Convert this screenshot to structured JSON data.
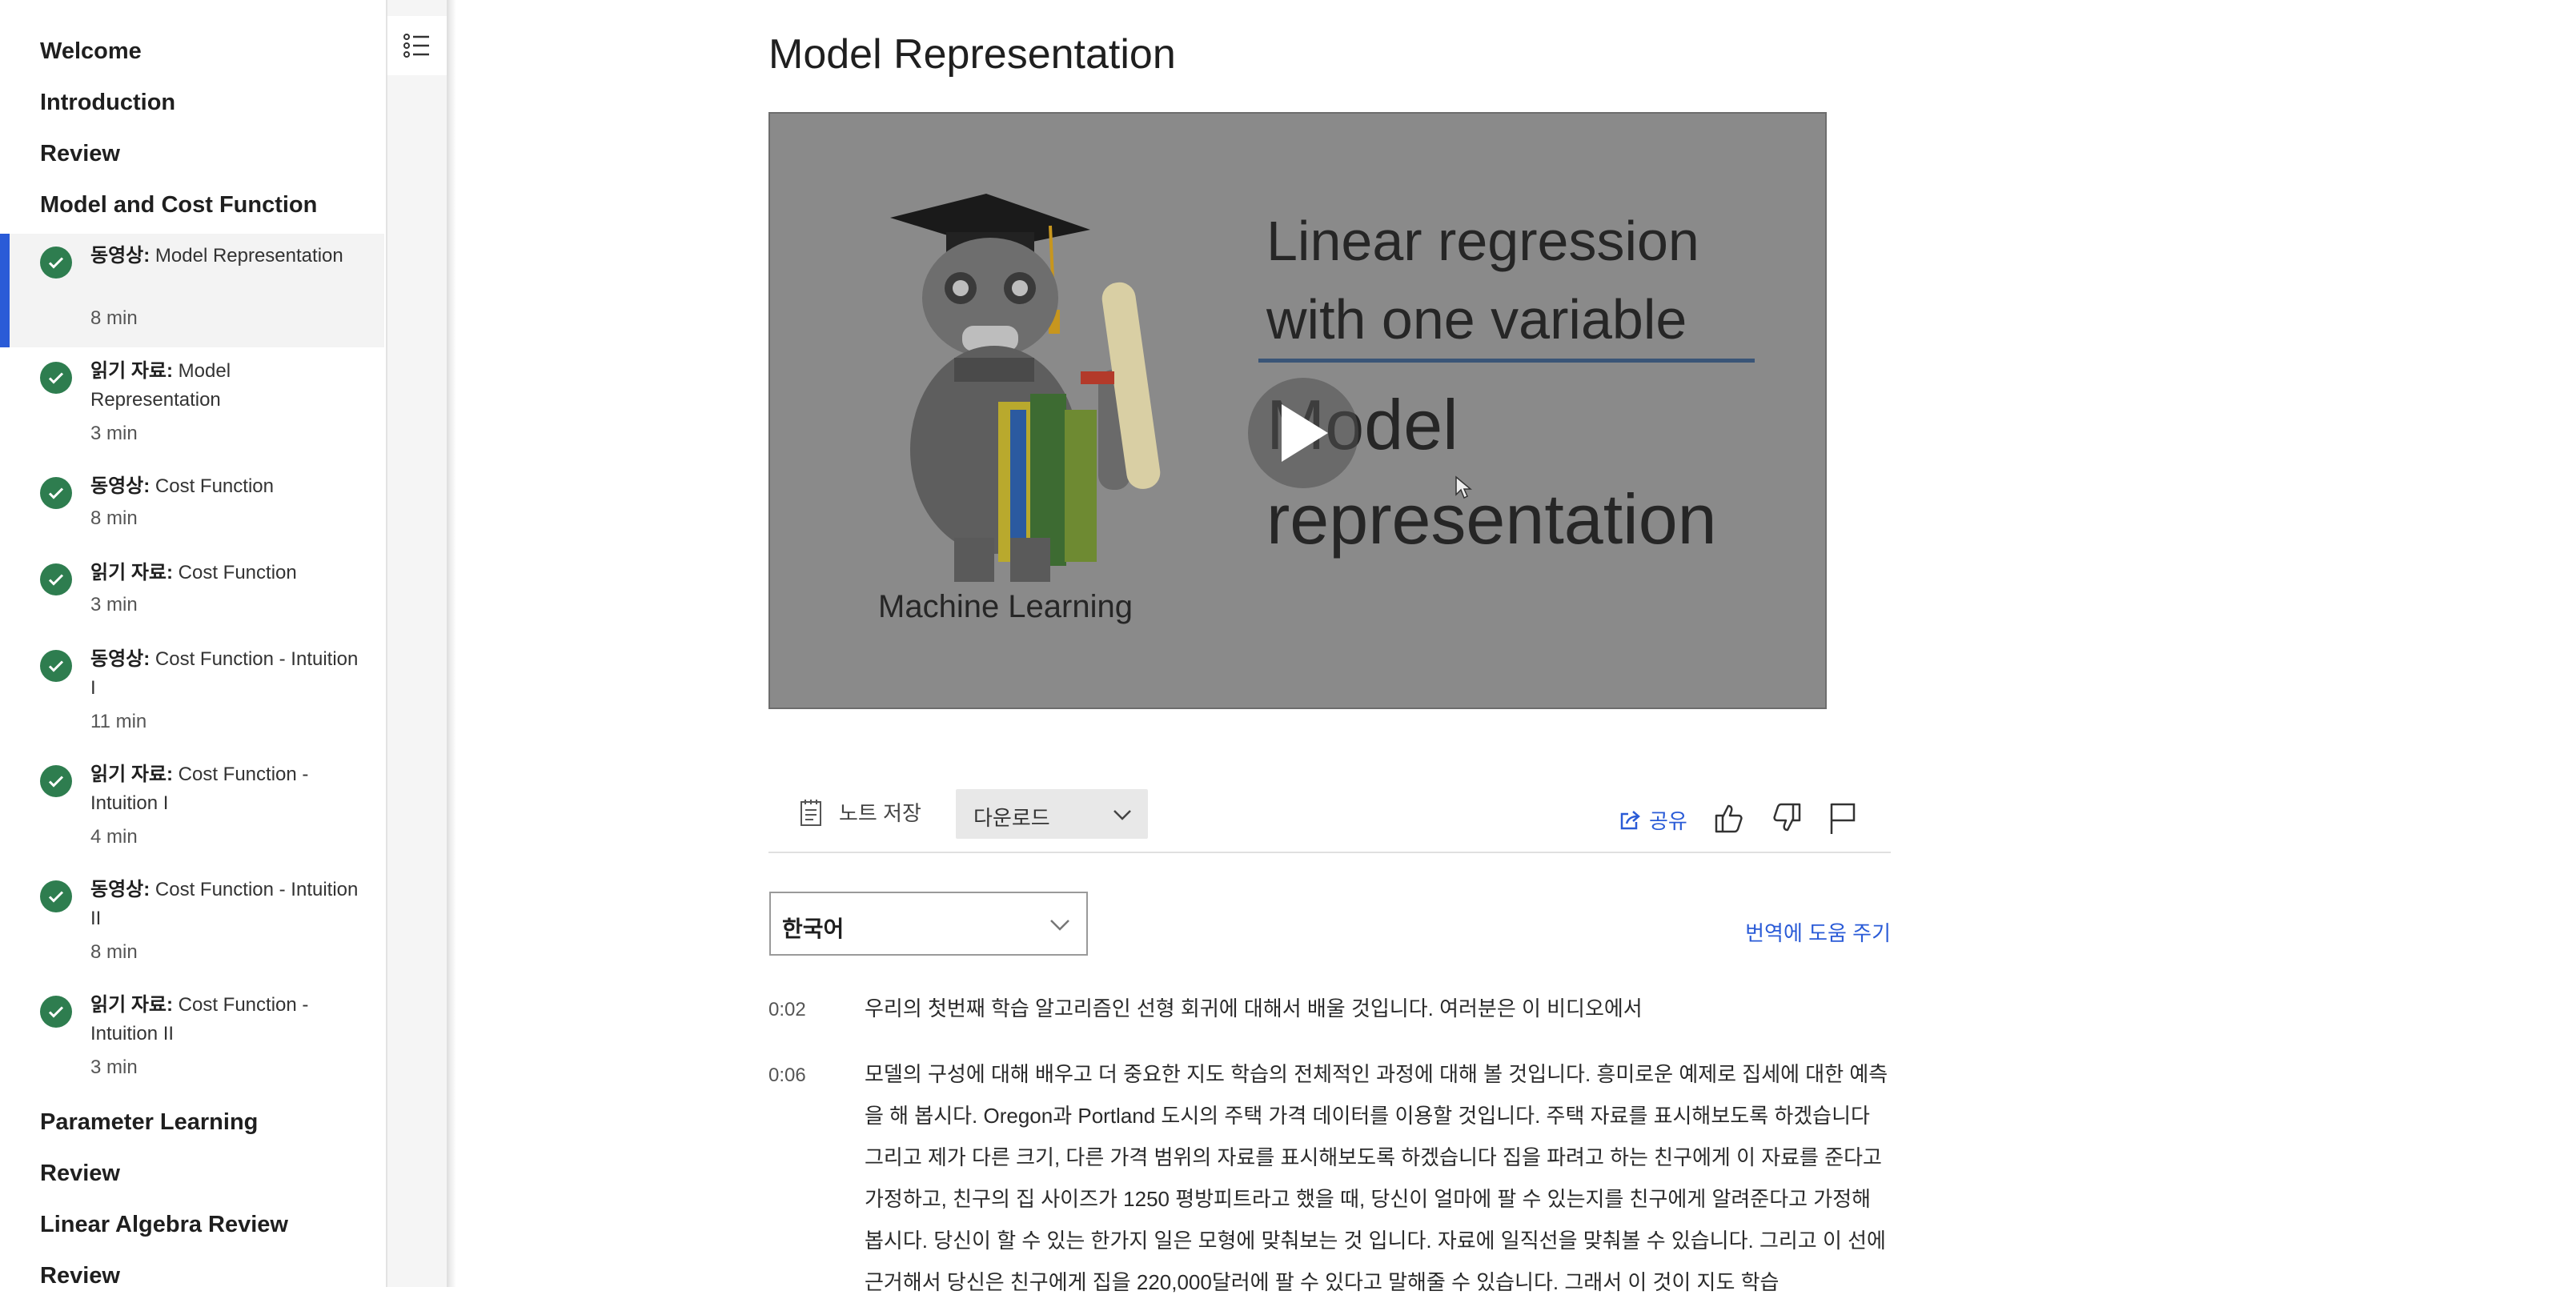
{
  "sidebar": {
    "sections_top": [
      {
        "label": "Welcome"
      },
      {
        "label": "Introduction"
      },
      {
        "label": "Review"
      },
      {
        "label": "Model and Cost Function"
      }
    ],
    "items": [
      {
        "type": "동영상:",
        "title": "Model Representation",
        "duration": "8 min",
        "active": true
      },
      {
        "type": "읽기 자료:",
        "title": "Model Representation",
        "duration": "3 min",
        "active": false
      },
      {
        "type": "동영상:",
        "title": "Cost Function",
        "duration": "8 min",
        "active": false
      },
      {
        "type": "읽기 자료:",
        "title": "Cost Function",
        "duration": "3 min",
        "active": false
      },
      {
        "type": "동영상:",
        "title": "Cost Function - Intuition I",
        "duration": "11 min",
        "active": false
      },
      {
        "type": "읽기 자료:",
        "title": "Cost Function - Intuition I",
        "duration": "4 min",
        "active": false
      },
      {
        "type": "동영상:",
        "title": "Cost Function - Intuition II",
        "duration": "8 min",
        "active": false
      },
      {
        "type": "읽기 자료:",
        "title": "Cost Function - Intuition II",
        "duration": "3 min",
        "active": false
      }
    ],
    "sections_bottom": [
      {
        "label": "Parameter Learning"
      },
      {
        "label": "Review"
      },
      {
        "label": "Linear Algebra Review"
      },
      {
        "label": "Review"
      }
    ]
  },
  "main": {
    "page_title": "Model Representation",
    "video": {
      "slide_title_line1": "Linear regression",
      "slide_title_line2": "with one variable",
      "slide_subtitle_line1": "Model",
      "slide_subtitle_line2": "representation",
      "caption": "Machine Learning"
    },
    "toolbar": {
      "notes_label": "노트 저장",
      "download_label": "다운로드",
      "share_label": "공유"
    },
    "language": {
      "selected": "한국어",
      "help_link": "번역에 도움 주기"
    },
    "transcript": [
      {
        "time": "0:02",
        "text": "우리의 첫번째 학습 알고리즘인 선형 회귀에 대해서 배울 것입니다. 여러분은 이 비디오에서"
      },
      {
        "time": "0:06",
        "text": "모델의 구성에 대해 배우고 더 중요한 지도 학습의 전체적인 과정에 대해 볼 것입니다. 흥미로운 예제로 집세에 대한 예측을 해 봅시다. Oregon과 Portland 도시의 주택 가격 데이터를 이용할 것입니다. 주택 자료를 표시해보도록 하겠습니다 그리고 제가 다른 크기, 다른 가격 범위의 자료를 표시해보도록 하겠습니다 집을 파려고 하는 친구에게 이 자료를 준다고 가정하고, 친구의 집 사이즈가 1250 평방피트라고 했을 때, 당신이 얼마에 팔 수 있는지를 친구에게 알려준다고 가정해봅시다. 당신이 할 수 있는 한가지 일은 모형에 맞춰보는 것 입니다. 자료에 일직선을 맞춰볼 수 있습니다. 그리고 이 선에 근거해서 당신은 친구에게 집을 220,000달러에 팔 수 있다고 말해줄 수 있습니다. 그래서 이 것이 지도 학습"
      }
    ]
  },
  "colors": {
    "accent": "#2a5bd7",
    "check": "#2e7d4f"
  }
}
